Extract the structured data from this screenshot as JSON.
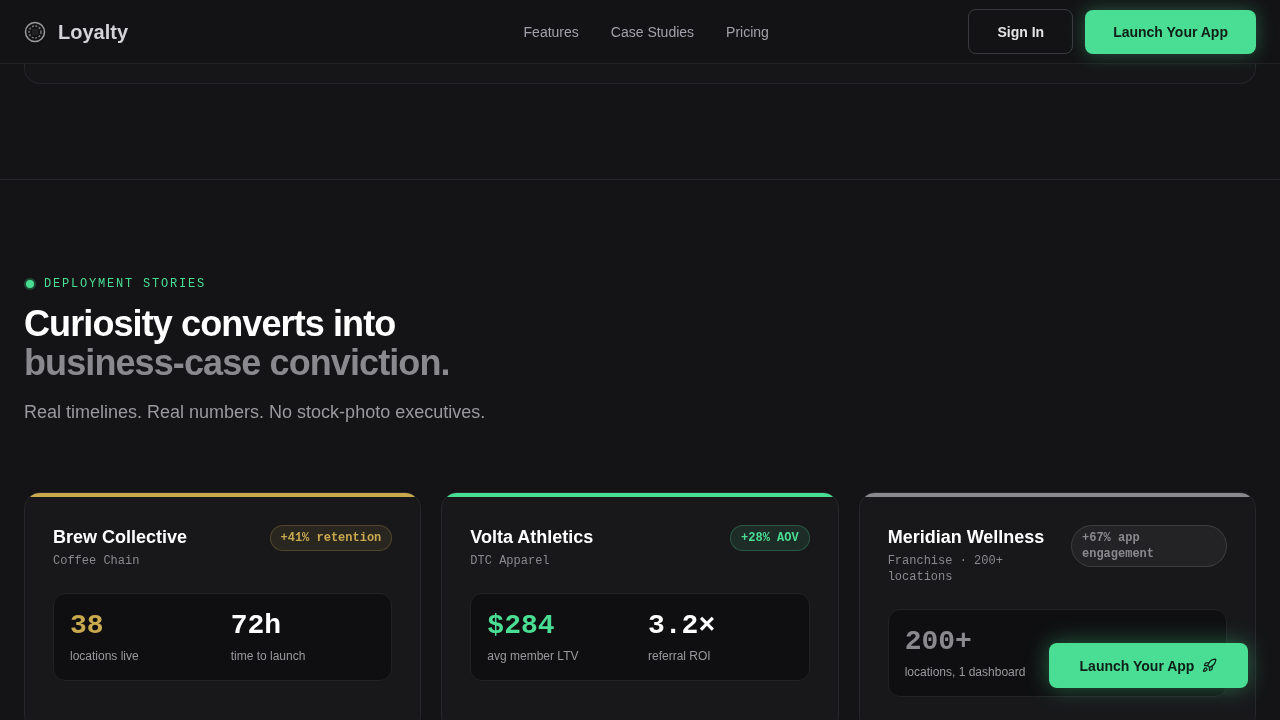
{
  "header": {
    "brand": "Loyalty",
    "nav": [
      "Features",
      "Case Studies",
      "Pricing"
    ],
    "sign_in": "Sign In",
    "launch": "Launch Your App"
  },
  "section": {
    "eyebrow": "DEPLOYMENT STORIES",
    "title_line_1": "Curiosity converts into",
    "title_line_2": "business-case conviction.",
    "subtitle": "Real timelines. Real numbers. No stock-photo executives."
  },
  "cards": [
    {
      "name": "Brew Collective",
      "category": "Coffee Chain",
      "badge": "+41% retention",
      "color": "#c9a94e",
      "metrics": [
        {
          "value": "38",
          "label": "locations live"
        },
        {
          "value": "72h",
          "label": "time to launch"
        }
      ]
    },
    {
      "name": "Volta Athletics",
      "category": "DTC Apparel",
      "badge": "+28% AOV",
      "color": "#4ade94",
      "metrics": [
        {
          "value": "$284",
          "label": "avg member LTV"
        },
        {
          "value": "3.2×",
          "label": "referral ROI"
        }
      ]
    },
    {
      "name": "Meridian Wellness",
      "category": "Franchise · 200+ locations",
      "badge": "+67% app engagement",
      "color": "#8a8a8e",
      "metrics": [
        {
          "value": "200+",
          "label": "locations, 1 dashboard"
        }
      ]
    }
  ],
  "floating_button": "Launch Your App"
}
